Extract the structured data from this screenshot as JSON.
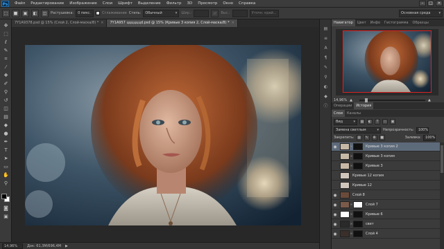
{
  "menu": {
    "logo": "Ps",
    "items": [
      "Файл",
      "Редактирование",
      "Изображение",
      "Слои",
      "Шрифт",
      "Выделение",
      "Фильтр",
      "3D",
      "Просмотр",
      "Окно",
      "Справка"
    ],
    "window_controls": [
      "–",
      "□",
      "×"
    ]
  },
  "options": {
    "feather_label": "Растушевка:",
    "feather_value": "0 пикс.",
    "antialias_label": "Сглаживание",
    "style_label": "Стиль:",
    "style_value": "Обычный",
    "width_label": "Шир.:",
    "height_label": "Выс.:",
    "refine_label": "Уточн. край...",
    "workspace_value": "Основная среда"
  },
  "tabs": [
    {
      "label": "7Y1A9378.psd @ 15% (Слой 2, Слой-маска/8) *",
      "close": "×"
    },
    {
      "label": "7Y1A957 ццццццd.psd @ 15% (Кривые 3 копия 2, Слой-маска/8) *",
      "close": "×"
    }
  ],
  "status": {
    "zoom": "14,96%",
    "doc_info": "Док: 61,3M/696,4M",
    "arrow": "▶"
  },
  "navigator": {
    "tabs": [
      "Навигатор",
      "Цвет",
      "Инфо",
      "Гистограмма",
      "Образцы"
    ],
    "zoom": "14,96%"
  },
  "actions": {
    "tabs": [
      "Операции",
      "История"
    ]
  },
  "layers_panel": {
    "tabs": [
      "Слои",
      "Каналы"
    ],
    "filter_kind": "Вид",
    "blend_mode": "Замена светлым",
    "opacity_label": "Непрозрачность:",
    "opacity_value": "100%",
    "lock_label": "Закрепить:",
    "fill_label": "Заливка:",
    "fill_value": "100%",
    "layers": [
      {
        "name": "Кривые 3 копия 2",
        "selected": true,
        "eye": true
      },
      {
        "name": "Кривые 3 копия",
        "selected": false,
        "eye": false
      },
      {
        "name": "Кривые 3",
        "selected": false,
        "eye": false
      },
      {
        "name": "Кривые 12 копия",
        "selected": false,
        "eye": false
      },
      {
        "name": "Кривые 12",
        "selected": false,
        "eye": false
      },
      {
        "name": "Слой 8",
        "selected": false,
        "eye": true
      },
      {
        "name": "Слой 7",
        "selected": false,
        "eye": true
      },
      {
        "name": "Кривые 6",
        "selected": false,
        "eye": true
      },
      {
        "name": "свет",
        "selected": false,
        "eye": true
      },
      {
        "name": "Слой 4",
        "selected": false,
        "eye": true
      }
    ]
  },
  "colors": {
    "selected_layer": "#5d6a7a",
    "accent": "#35a2f5",
    "nav_frame": "#dd2222"
  },
  "icons": {
    "toolbar": [
      "move-icon",
      "marquee-icon",
      "lasso-icon",
      "quick-select-icon",
      "crop-icon",
      "eyedropper-icon",
      "healing-icon",
      "brush-icon",
      "clone-stamp-icon",
      "history-brush-icon",
      "eraser-icon",
      "gradient-icon",
      "blur-icon",
      "dodge-icon",
      "pen-icon",
      "type-icon",
      "path-select-icon",
      "shape-icon",
      "hand-icon",
      "zoom-icon"
    ]
  }
}
